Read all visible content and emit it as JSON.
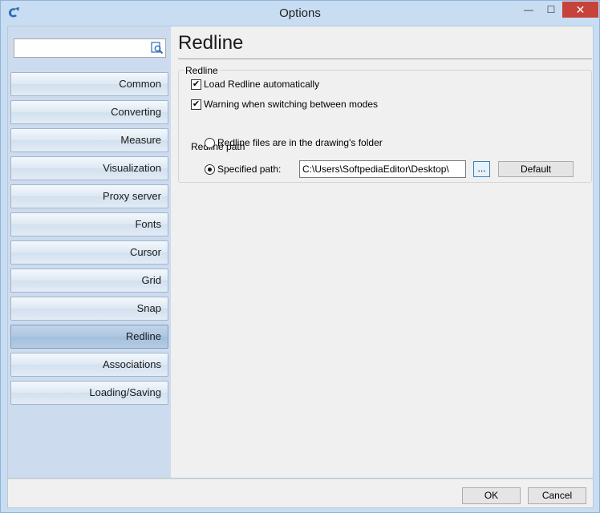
{
  "window": {
    "title": "Options",
    "minimize_glyph": "—",
    "maximize_glyph": "☐",
    "close_glyph": "✕"
  },
  "sidebar": {
    "search": {
      "value": "",
      "placeholder": ""
    },
    "items": [
      {
        "label": "Common"
      },
      {
        "label": "Converting"
      },
      {
        "label": "Measure"
      },
      {
        "label": "Visualization"
      },
      {
        "label": "Proxy server"
      },
      {
        "label": "Fonts"
      },
      {
        "label": "Cursor"
      },
      {
        "label": "Grid"
      },
      {
        "label": "Snap"
      },
      {
        "label": "Redline",
        "active": true
      },
      {
        "label": "Associations"
      },
      {
        "label": "Loading/Saving"
      }
    ]
  },
  "main": {
    "page_title": "Redline",
    "group": {
      "legend": "Redline",
      "load_automatically": {
        "label": "Load Redline automatically",
        "checked": true
      },
      "warning_switching": {
        "label": "Warning when switching between modes",
        "checked": true
      },
      "path_label": "Redline path",
      "radio_drawing_folder": {
        "label": "Redline files are in the drawing's folder",
        "selected": false
      },
      "radio_specified": {
        "label": "Specified path:",
        "selected": true
      },
      "path_value": "C:\\Users\\SoftpediaEditor\\Desktop\\",
      "browse_label": "...",
      "default_label": "Default"
    }
  },
  "footer": {
    "ok_label": "OK",
    "cancel_label": "Cancel"
  },
  "colors": {
    "sidebar_bg": "#ccdcee",
    "close_button": "#c7423a",
    "frame": "#c8ddf2"
  }
}
